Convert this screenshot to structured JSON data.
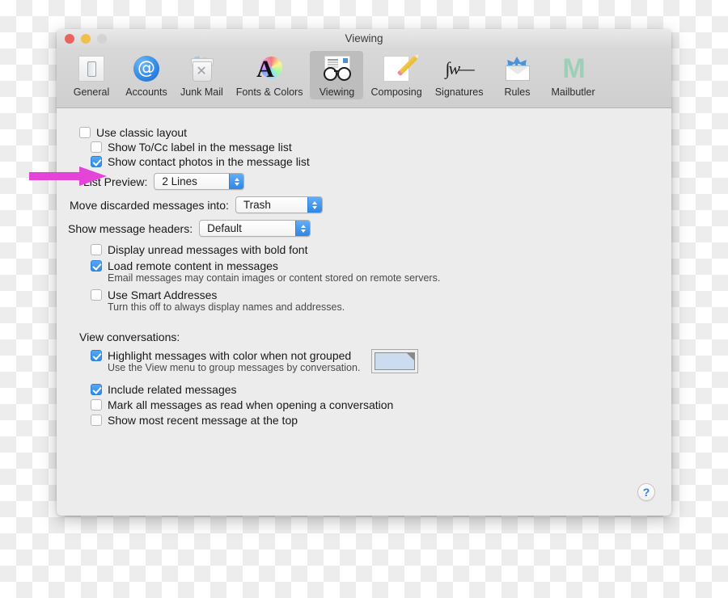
{
  "window": {
    "title": "Viewing",
    "controls": {
      "close": "close-button",
      "minimize": "minimize-button",
      "zoom": "zoom-button"
    }
  },
  "toolbar": {
    "items": [
      {
        "label": "General",
        "icon": "general-icon",
        "selected": false
      },
      {
        "label": "Accounts",
        "icon": "accounts-at-icon",
        "selected": false
      },
      {
        "label": "Junk Mail",
        "icon": "trash-icon",
        "selected": false
      },
      {
        "label": "Fonts & Colors",
        "icon": "font-colors-icon",
        "selected": false
      },
      {
        "label": "Viewing",
        "icon": "glasses-icon",
        "selected": true
      },
      {
        "label": "Composing",
        "icon": "compose-icon",
        "selected": false
      },
      {
        "label": "Signatures",
        "icon": "signature-icon",
        "selected": false
      },
      {
        "label": "Rules",
        "icon": "rules-icon",
        "selected": false
      },
      {
        "label": "Mailbutler",
        "icon": "mailbutler-icon",
        "selected": false
      }
    ]
  },
  "content": {
    "use_classic_layout": {
      "label": "Use classic layout",
      "checked": false
    },
    "show_tocc_label": {
      "label": "Show To/Cc label in the message list",
      "checked": false
    },
    "show_contact_photos": {
      "label": "Show contact photos in the message list",
      "checked": true
    },
    "list_preview": {
      "label": "List Preview:",
      "value": "2 Lines"
    },
    "move_discarded": {
      "label": "Move discarded messages into:",
      "value": "Trash"
    },
    "show_headers": {
      "label": "Show message headers:",
      "value": "Default"
    },
    "display_unread_bold": {
      "label": "Display unread messages with bold font",
      "checked": false
    },
    "load_remote_content": {
      "label": "Load remote content in messages",
      "checked": true,
      "hint": "Email messages may contain images or content stored on remote servers."
    },
    "use_smart_addresses": {
      "label": "Use Smart Addresses",
      "checked": false,
      "hint": "Turn this off to always display names and addresses."
    },
    "view_conversations": {
      "title": "View conversations:",
      "highlight_messages": {
        "label": "Highlight messages with color when not grouped",
        "checked": true,
        "hint": "Use the View menu to group messages by conversation.",
        "color": "#ccdcee"
      },
      "include_related": {
        "label": "Include related messages",
        "checked": true
      },
      "mark_all_read": {
        "label": "Mark all messages as read when opening a conversation",
        "checked": false
      },
      "show_most_recent": {
        "label": "Show most recent message at the top",
        "checked": false
      }
    },
    "help_button": {
      "label": "?"
    }
  },
  "annotation": {
    "arrow_color": "#e544d8"
  }
}
